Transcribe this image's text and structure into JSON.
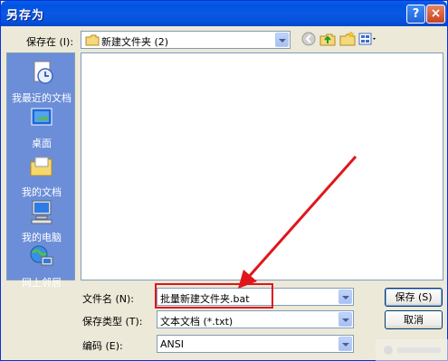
{
  "window": {
    "title": "另存为"
  },
  "titlebar": {
    "help": "?",
    "close": "×"
  },
  "toolbar": {
    "save_in_label": "保存在 (I):",
    "save_in_value": "新建文件夹  (2)",
    "icons": [
      "back-icon",
      "up-folder-icon",
      "new-folder-icon",
      "views-menu-icon"
    ]
  },
  "places": [
    {
      "label": "我最近的文档",
      "icon": "recent-documents-icon"
    },
    {
      "label": "桌面",
      "icon": "desktop-icon"
    },
    {
      "label": "我的文档",
      "icon": "my-documents-icon"
    },
    {
      "label": "我的电脑",
      "icon": "my-computer-icon"
    },
    {
      "label": "网上邻居",
      "icon": "network-places-icon"
    }
  ],
  "form": {
    "filename_label": "文件名 (N):",
    "filename_value": "批量新建文件夹.bat",
    "filetype_label": "保存类型 (T):",
    "filetype_value": "文本文档 (*.txt)",
    "encoding_label": "编码 (E):",
    "encoding_value": "ANSI"
  },
  "buttons": {
    "save": "保存 (S)",
    "cancel": "取消"
  },
  "colors": {
    "highlight_box": "#e0161b",
    "arrow": "#e0161b",
    "places_bg": "#6c8ed8",
    "titlebar": "#0053e1"
  }
}
